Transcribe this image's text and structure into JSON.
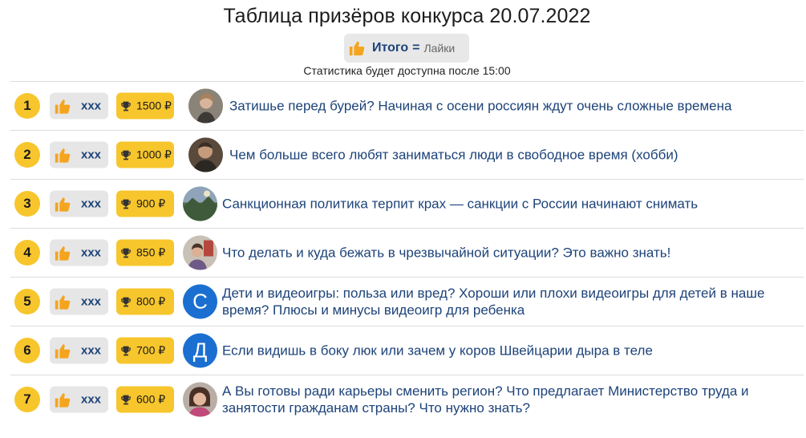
{
  "page": {
    "title": "Таблица призёров конкурса 20.07.2022",
    "totals_label": "Итого",
    "totals_eq": "=",
    "totals_sub": "Лайки",
    "note": "Статистика будет доступна после 15:00"
  },
  "colors": {
    "accent": "#f7c62c",
    "link": "#1d4379",
    "thumb": "#f5a41d",
    "badge_bg": "#e6e6e6"
  },
  "rows": [
    {
      "rank": "1",
      "likes": "xxx",
      "prize": "1500 ₽",
      "avatar": "photo",
      "avatar_letter": "",
      "text": "Затишье перед бурей? Начиная с осени россиян ждут очень сложные времена"
    },
    {
      "rank": "2",
      "likes": "xxx",
      "prize": "1000 ₽",
      "avatar": "photo",
      "avatar_letter": "",
      "text": "Чем больше всего любят заниматься люди в свободное время (хобби)"
    },
    {
      "rank": "3",
      "likes": "xxx",
      "prize": "900 ₽",
      "avatar": "photo",
      "avatar_letter": "",
      "text": "Санкционная политика терпит крах — санкции с России начинают снимать"
    },
    {
      "rank": "4",
      "likes": "xxx",
      "prize": "850 ₽",
      "avatar": "photo",
      "avatar_letter": "",
      "text": "Что делать и куда бежать в чрезвычайной ситуации? Это важно знать!"
    },
    {
      "rank": "5",
      "likes": "xxx",
      "prize": "800 ₽",
      "avatar": "letter",
      "avatar_letter": "С",
      "text": "Дети и видеоигры: польза или вред? Хороши или плохи видеоигры для детей в наше время? Плюсы и минусы видеоигр для ребенка"
    },
    {
      "rank": "6",
      "likes": "xxx",
      "prize": "700 ₽",
      "avatar": "letter",
      "avatar_letter": "Д",
      "text": "Если видишь в боку люк или зачем у коров Швейцарии дыра в теле"
    },
    {
      "rank": "7",
      "likes": "xxx",
      "prize": "600 ₽",
      "avatar": "photo",
      "avatar_letter": "",
      "text": "А Вы готовы ради карьеры сменить регион? Что предлагает Министерство труда и занятости гражданам страны? Что нужно знать?"
    }
  ]
}
